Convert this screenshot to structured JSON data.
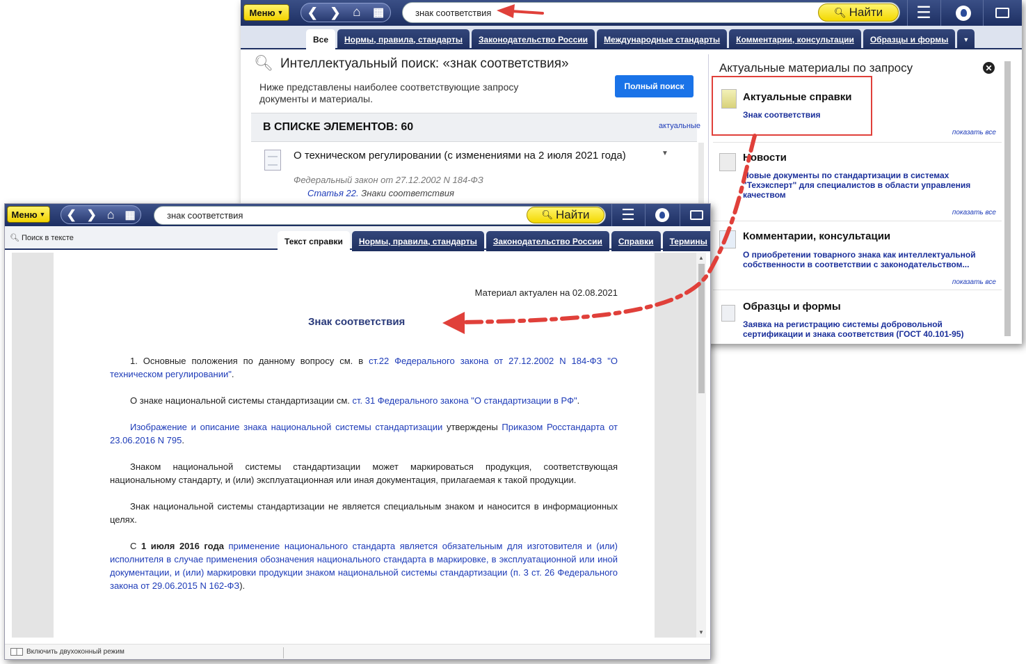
{
  "back": {
    "toolbar": {
      "menu_label": "Меню",
      "search_value": "знак соответствия",
      "find_label": "Найти"
    },
    "tabs": [
      "Все",
      "Нормы, правила, стандарты",
      "Законодательство России",
      "Международные стандарты",
      "Комментарии, консультации",
      "Образцы и формы"
    ],
    "search_header": {
      "title": "Интеллектуальный поиск: «знак соответствия»",
      "description": "Ниже представлены наиболее соответствующие запросу документы и материалы.",
      "full_search_label": "Полный поиск"
    },
    "list": {
      "count_label": "В СПИСКЕ ЭЛЕМЕНТОВ: 60",
      "sort_label": "актуальные"
    },
    "result": {
      "title": "О техническом регулировании (с изменениями на 2 июля 2021 года)",
      "subtitle": "Федеральный закон от 27.12.2002 N 184-ФЗ",
      "article_link": "Статья 22.",
      "article_text": "Знаки соответствия"
    },
    "sidebar": {
      "title": "Актуальные материалы по запросу",
      "show_all": "показать все",
      "sections": [
        {
          "title": "Актуальные справки",
          "link": "Знак соответствия"
        },
        {
          "title": "Новости",
          "link": "Новые документы по стандартизации в системах \"Техэксперт\" для специалистов в области управления качеством"
        },
        {
          "title": "Комментарии, консультации",
          "link": "О приобретении товарного знака как интеллектуальной собственности в соответствии с законодательством..."
        },
        {
          "title": "Образцы и формы",
          "link": "Заявка на регистрацию системы добровольной сертификации и знака соответствия (ГОСТ 40.101-95)"
        }
      ]
    }
  },
  "front": {
    "toolbar": {
      "menu_label": "Меню",
      "search_value": "знак соответствия",
      "find_label": "Найти"
    },
    "search_in_text": "Поиск в тексте",
    "tabs": [
      "Текст справки",
      "Нормы, правила, стандарты",
      "Законодательство России",
      "Справки",
      "Термины"
    ],
    "document": {
      "actual_date": "Материал актуален на 02.08.2021",
      "title": "Знак соответствия",
      "p1_prefix": "1. Основные положения по данному вопросу см. в ",
      "p1_link": "ст.22 Федерального закона от 27.12.2002 N 184-ФЗ \"О техническом регулировании\"",
      "p1_suffix": ".",
      "p2_prefix": "О знаке национальной системы стандартизации см. ",
      "p2_link": "ст. 31 Федерального закона \"О стандартизации в РФ\"",
      "p2_suffix": ".",
      "p3_link1": "Изображение и описание знака национальной системы стандартизации",
      "p3_middle": " утверждены ",
      "p3_link2": "Приказом Росстандарта от 23.06.2016 N 795",
      "p3_suffix": ".",
      "p4": "Знаком национальной системы стандартизации может маркироваться продукция, соответствующая национальному стандарту, и (или) эксплуатационная или иная документация, прилагаемая к такой продукции.",
      "p5": "Знак национальной системы стандартизации не является специальным знаком и наносится в информационных целях.",
      "p6_prefix": "С ",
      "p6_bold": "1 июля 2016 года",
      "p6_text": " применение национального стандарта является обязательным для изготовителя и (или) исполнителя в случае применения обозначения национального стандарта в маркировке, в эксплуатационной или иной документации, и (или) маркировки продукции знаком национальной системы стандартизации (",
      "p6_link": "п. 3 ст. 26 Федерального закона от 29.06.2015 N 162-ФЗ",
      "p6_suffix": ")."
    },
    "status": {
      "dual_mode": "Включить двухоконный режим"
    }
  },
  "colors": {
    "toolbar": "#1d2f62",
    "accent_yellow": "#f3d800",
    "link_blue": "#1d3bb8",
    "annotation_red": "#e0403a",
    "primary_button": "#1a73e8"
  }
}
